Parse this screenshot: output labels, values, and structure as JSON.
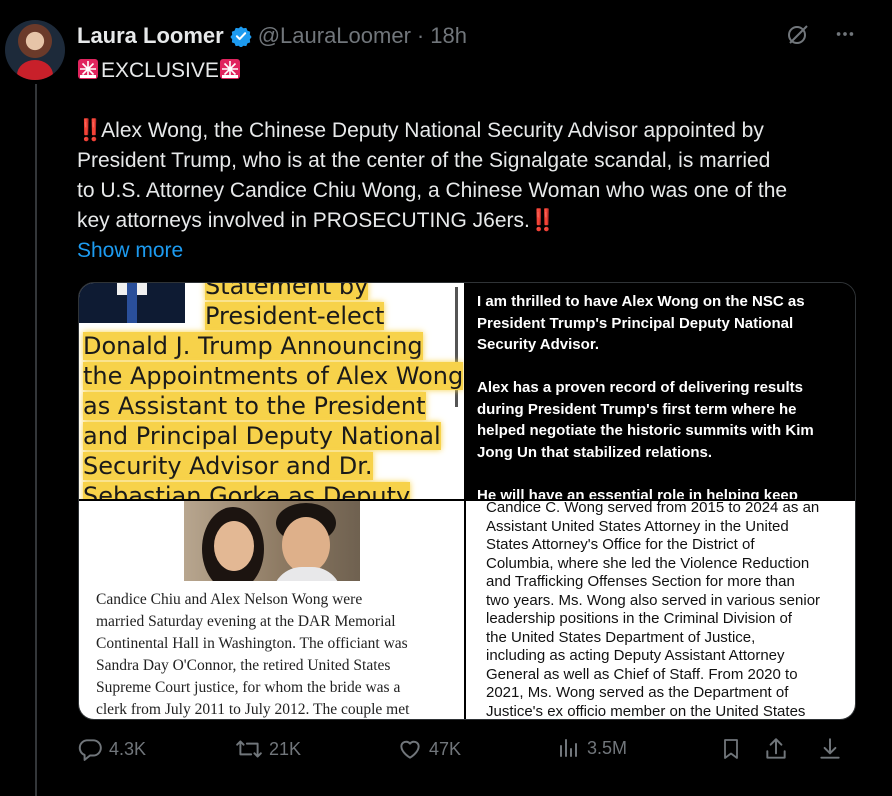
{
  "author": {
    "name": "Laura Loomer",
    "handle": "@LauraLoomer",
    "separator": "·",
    "time": "18h"
  },
  "post": {
    "badge_text": "EXCLUSIVE",
    "lines": [
      "Alex Wong, the Chinese Deputy National Security Advisor appointed by",
      "President Trump, who is at the center of the Signalgate scandal, is married",
      "to U.S. Attorney Candice Chiu Wong, a Chinese Woman who was one of the",
      "key attorneys involved in PROSECUTING J6ers."
    ],
    "emphasis": "‼️",
    "show_more": "Show more"
  },
  "media": {
    "tile1_lines": [
      "Statement by",
      "President-elect",
      "Donald J. Trump Announcing",
      "the Appointments of Alex Wong",
      "as Assistant to the President",
      "and Principal Deputy National",
      "Security Advisor and Dr.",
      "Sebastian Gorka as Deputy"
    ],
    "tile2_lines": [
      "I am thrilled to have Alex Wong on the NSC as",
      "President Trump's Principal Deputy National",
      "Security Advisor.",
      "",
      "Alex has a proven record of delivering results",
      "during President Trump's first term where he",
      "helped negotiate the historic summits with Kim",
      "Jong Un that stabilized relations.",
      "",
      "He will have an essential role in helping keep"
    ],
    "tile3_lines": [
      "Candice Chiu and Alex Nelson Wong were",
      "married Saturday evening at the DAR Memorial",
      "Continental Hall in Washington. The officiant was",
      "Sandra Day O'Connor, the retired United States",
      "Supreme Court justice, for whom the bride was a",
      "clerk from July 2011 to July 2012. The couple met"
    ],
    "tile4_lines": [
      "Candice C. Wong served from 2015 to 2024 as an",
      "Assistant United States Attorney in the United",
      "States Attorney's Office for the District of",
      "Columbia, where she led the Violence Reduction",
      "and Trafficking Offenses Section for more than",
      "two years. Ms. Wong also served in various senior",
      "leadership positions in the Criminal Division of",
      "the United States Department of Justice,",
      "including as acting Deputy Assistant Attorney",
      "General as well as Chief of Staff. From 2020 to",
      "2021, Ms. Wong served as the Department of",
      "Justice's ex officio member on the United States"
    ]
  },
  "actions": {
    "replies": "4.3K",
    "reposts": "21K",
    "likes": "47K",
    "views": "3.5M"
  },
  "icons": {
    "verified": "verified-badge-icon",
    "grok": "grok-icon",
    "more": "more-icon",
    "reply": "reply-icon",
    "repost": "repost-icon",
    "like": "like-icon",
    "views": "views-icon",
    "bookmark": "bookmark-icon",
    "share": "share-icon",
    "download": "download-icon"
  },
  "colors": {
    "background": "#000000",
    "text": "#e7e9ea",
    "muted": "#71767b",
    "link": "#1d9bf0",
    "verified": "#1d9bf0",
    "highlight": "#f7d24a",
    "siren": "#e0245e"
  }
}
